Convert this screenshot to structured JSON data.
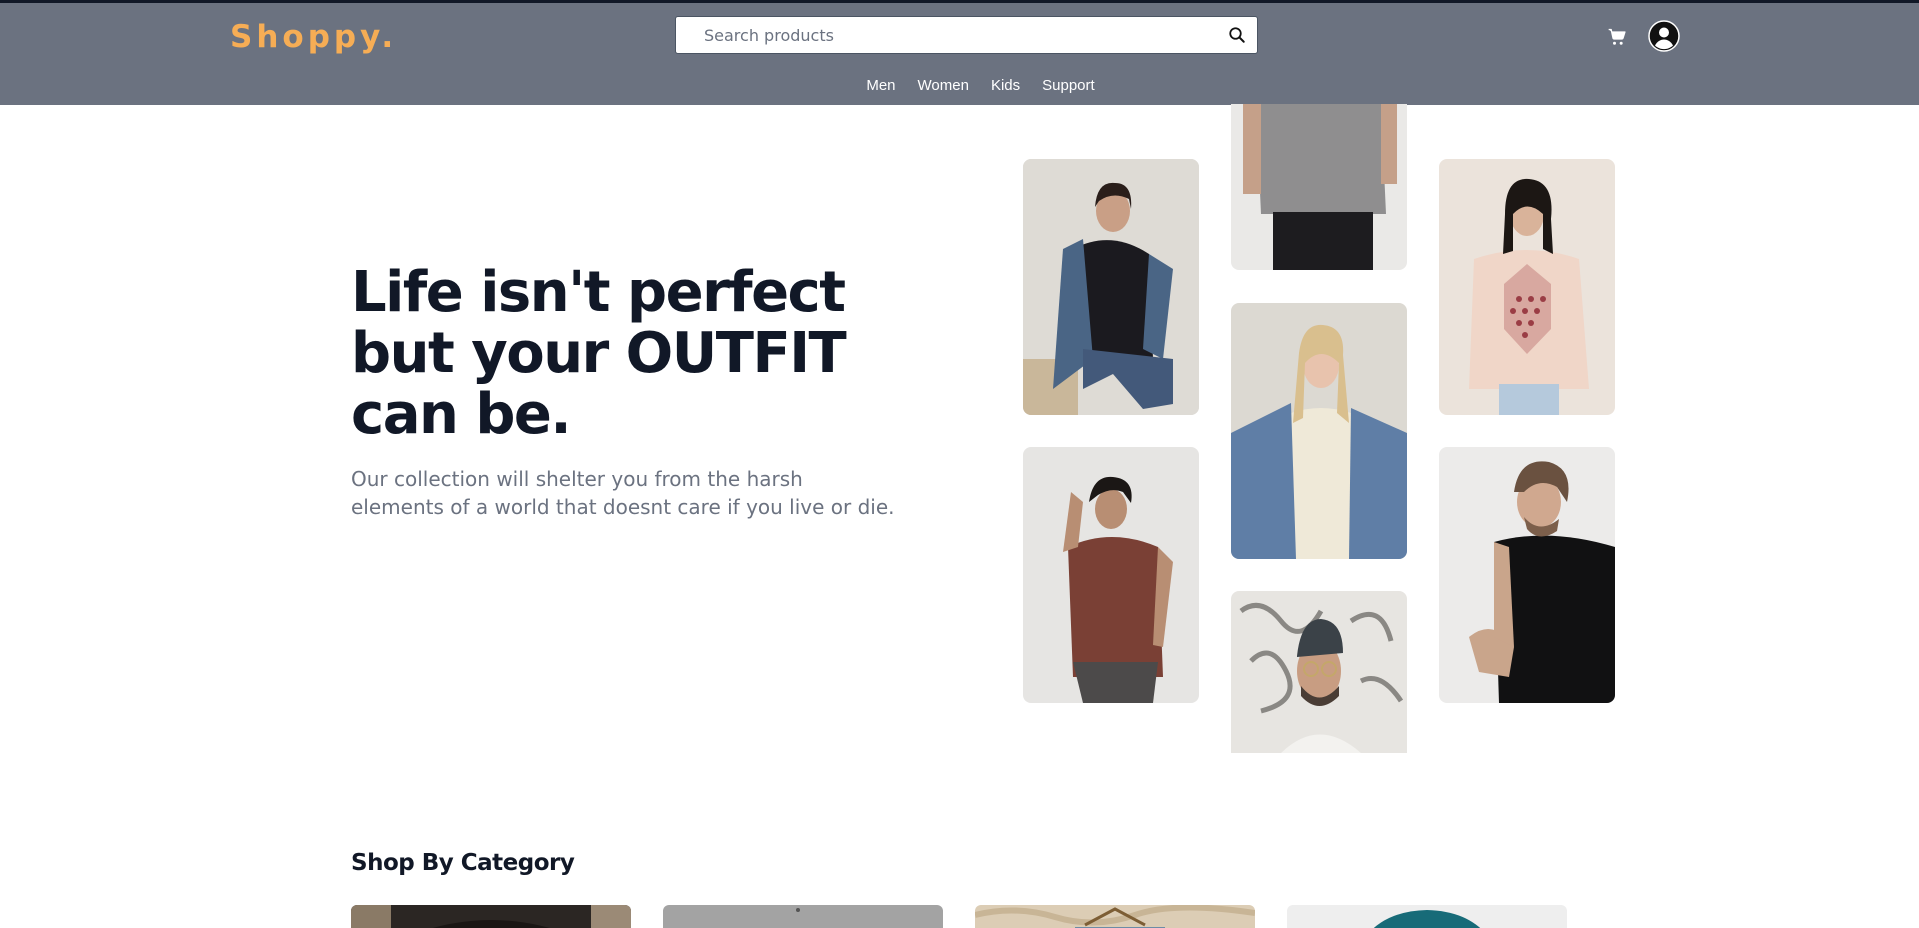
{
  "header": {
    "logo": "Shoppy.",
    "search_placeholder": "Search products",
    "nav": [
      "Men",
      "Women",
      "Kids",
      "Support"
    ]
  },
  "icons": {
    "search": "search-icon",
    "cart": "cart-icon",
    "account": "user-circle-icon"
  },
  "hero": {
    "title_lines": [
      "Life isn't perfect",
      "but your OUTFIT",
      "can be."
    ],
    "subtitle_lines": [
      "Our collection will shelter you from the harsh",
      "elements of a world that doesnt care if you live or die."
    ]
  },
  "gallery": [
    {
      "name": "woman-denim-jacket-photo"
    },
    {
      "name": "man-grey-tshirt-photo"
    },
    {
      "name": "woman-pink-tshirt-photo"
    },
    {
      "name": "woman-cream-top-denim-photo"
    },
    {
      "name": "man-brown-tshirt-photo"
    },
    {
      "name": "man-black-tshirt-photo"
    },
    {
      "name": "man-beanie-glasses-photo"
    }
  ],
  "categories": {
    "title": "Shop By Category"
  },
  "colors": {
    "header_bg": "#6b7280",
    "logo": "#f6ad55",
    "heading": "#111827",
    "subtext": "#6b7280"
  }
}
